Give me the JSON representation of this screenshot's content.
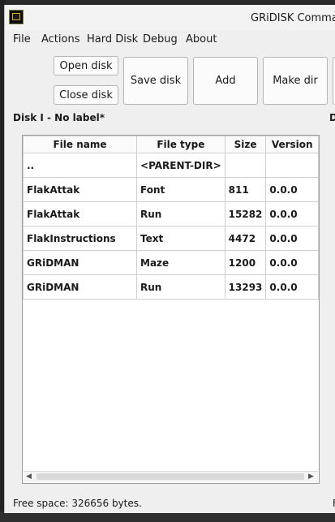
{
  "window": {
    "title": "GRiDISK Commar"
  },
  "menu": [
    "File",
    "Actions",
    "Hard Disk",
    "Debug",
    "About"
  ],
  "toolbar": {
    "open_disk": "Open disk",
    "close_disk": "Close disk",
    "save_disk": "Save disk",
    "add": "Add",
    "make_dir": "Make dir"
  },
  "panel": {
    "title": "Disk I - No label*",
    "second_title": "D"
  },
  "table": {
    "columns": [
      "File name",
      "File type",
      "Size",
      "Version"
    ],
    "rows": [
      [
        "..",
        "<PARENT-DIR>",
        "",
        ""
      ],
      [
        "FlakAttak",
        "Font",
        "811",
        "0.0.0"
      ],
      [
        "FlakAttak",
        "Run",
        "15282",
        "0.0.0"
      ],
      [
        "FlakInstructions",
        "Text",
        "4472",
        "0.0.0"
      ],
      [
        "GRiDMAN",
        "Maze",
        "1200",
        "0.0.0"
      ],
      [
        "GRiDMAN",
        "Run",
        "13293",
        "0.0.0"
      ]
    ]
  },
  "status": {
    "free_space": "Free space: 326656 bytes.",
    "second": "F"
  },
  "icons": {
    "app": "gridisk-app-icon",
    "scroll_left": "scroll-left-icon",
    "scroll_right": "scroll-right-icon"
  }
}
